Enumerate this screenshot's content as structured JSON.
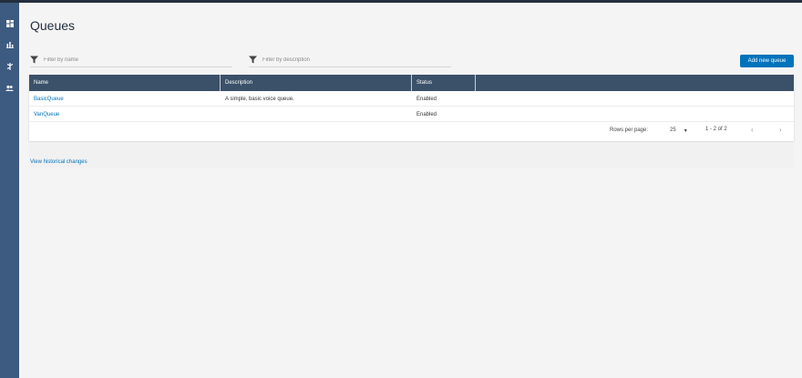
{
  "page": {
    "title": "Queues"
  },
  "sidebar": {
    "items": [
      {
        "name": "dashboard",
        "icon": "dashboard-icon"
      },
      {
        "name": "metrics",
        "icon": "bar-chart-icon"
      },
      {
        "name": "routing",
        "icon": "routing-icon"
      },
      {
        "name": "users",
        "icon": "users-icon"
      }
    ]
  },
  "filters": {
    "name_placeholder": "Filter by name",
    "description_placeholder": "Filter by description"
  },
  "actions": {
    "add_queue_label": "Add new queue"
  },
  "table": {
    "headers": {
      "name": "Name",
      "description": "Description",
      "status": "Status"
    },
    "rows": [
      {
        "name": "BasicQueue",
        "description": "A simple, basic voice queue.",
        "status": "Enabled"
      },
      {
        "name": "VanQueue",
        "description": "",
        "status": "Enabled"
      }
    ]
  },
  "pagination": {
    "rows_per_page_label": "Rows per page:",
    "rows_per_page_value": "25",
    "range_label": "1 - 2 of 2"
  },
  "links": {
    "history_label": "View historical changes"
  },
  "colors": {
    "header_bg": "#3b5169",
    "sidebar_bg": "#3d5a80",
    "accent": "#0073bb"
  }
}
